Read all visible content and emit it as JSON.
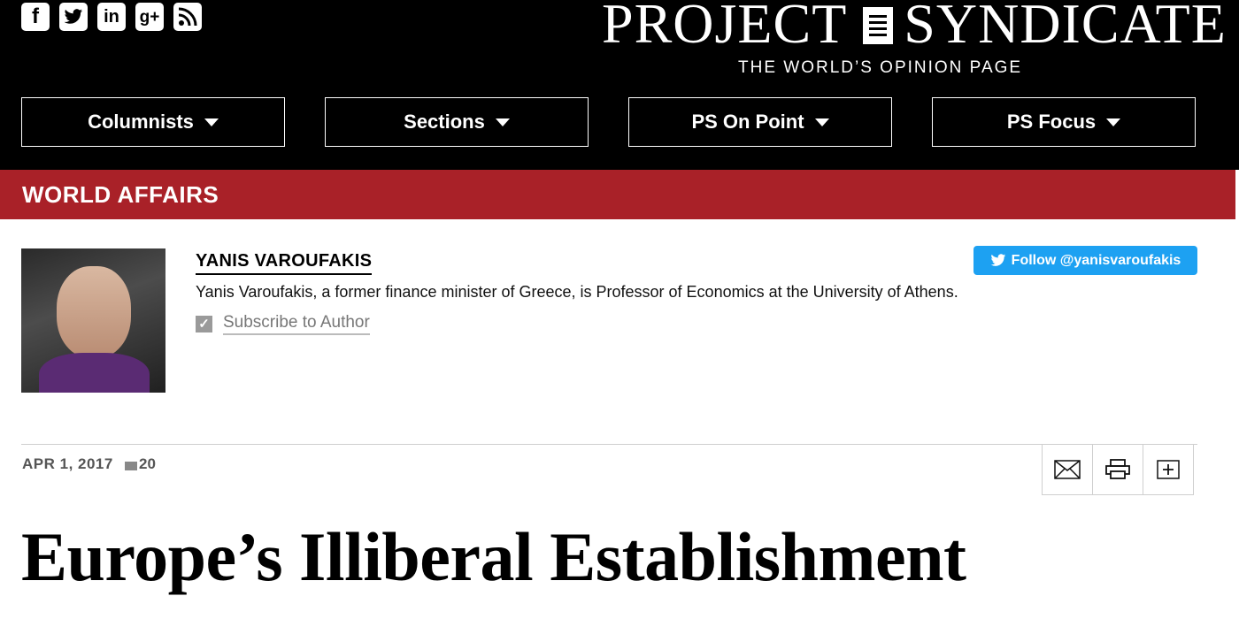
{
  "header": {
    "logo_left": "PROJECT",
    "logo_right": "SYNDICATE",
    "tagline": "THE WORLD’S OPINION PAGE",
    "social": [
      {
        "name": "facebook-icon",
        "glyph": "f"
      },
      {
        "name": "twitter-icon",
        "glyph": "t"
      },
      {
        "name": "linkedin-icon",
        "glyph": "in"
      },
      {
        "name": "googleplus-icon",
        "glyph": "g+"
      },
      {
        "name": "rss-icon",
        "glyph": "rss"
      }
    ],
    "nav": [
      {
        "label": "Columnists"
      },
      {
        "label": "Sections"
      },
      {
        "label": "PS On Point"
      },
      {
        "label": "PS Focus"
      }
    ]
  },
  "section": {
    "title": "WORLD AFFAIRS",
    "color": "#a92128"
  },
  "author": {
    "name": "YANIS VAROUFAKIS",
    "bio": "Yanis Varoufakis, a former finance minister of Greece, is Professor of Economics at the University of Athens.",
    "subscribe_label": "Subscribe to Author",
    "follow_label": "Follow @yanisvaroufakis",
    "follow_color": "#1da1f2"
  },
  "meta": {
    "date": "APR 1, 2017",
    "comment_count": "20"
  },
  "tools": [
    {
      "name": "email-icon"
    },
    {
      "name": "print-icon"
    },
    {
      "name": "add-icon"
    }
  ],
  "article": {
    "headline": "Europe’s Illiberal Establishment"
  }
}
